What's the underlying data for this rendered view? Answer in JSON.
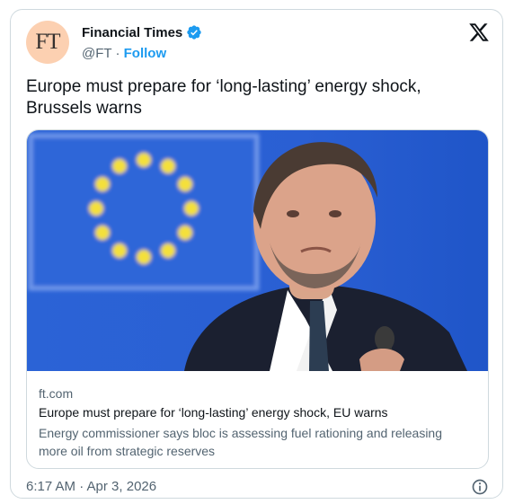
{
  "author": {
    "name": "Financial Times",
    "handle": "@FT",
    "separator": " · ",
    "follow_label": "Follow",
    "avatar_text": "FT",
    "avatar_color": "#fcd0b1"
  },
  "tweet": {
    "text": "Europe must prepare for ‘long-lasting’ energy shock, Brussels warns"
  },
  "link_card": {
    "domain": "ft.com",
    "title": "Europe must prepare for ‘long-lasting’ energy shock, EU warns",
    "description": "Energy commissioner says bloc is assessing fuel rationing and releasing more oil from strategic reserves"
  },
  "meta": {
    "time": "6:17 AM · Apr 3, 2026"
  },
  "icons": {
    "verified": "verified-badge-icon",
    "platform": "x-logo-icon",
    "info": "info-icon"
  },
  "colors": {
    "accent": "#1d9bf0",
    "text": "#0f1419",
    "muted": "#536471",
    "border": "#cfd9de"
  }
}
